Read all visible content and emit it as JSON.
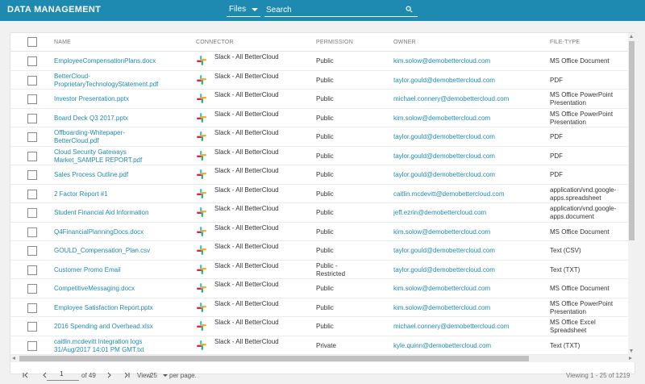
{
  "app": {
    "title": "DATA MANAGEMENT"
  },
  "search": {
    "scope": "Files",
    "placeholder": "Search"
  },
  "columns": [
    "NAME",
    "CONNECTOR",
    "PERMISSION",
    "OWNER",
    "FILE-TYPE"
  ],
  "rows": [
    {
      "name": [
        "EmployeeCompensationPlans.docx"
      ],
      "connector": "Slack - All BetterCloud",
      "permission": [
        "Public"
      ],
      "owner": "kim.solow@demobettercloud.com",
      "filetype": [
        "MS Office Document"
      ]
    },
    {
      "name": [
        "BetterCloud-",
        "ProprietaryTechnologyStatement.pdf"
      ],
      "connector": "Slack - All BetterCloud",
      "permission": [
        "Public"
      ],
      "owner": "taylor.gould@demobettercloud.com",
      "filetype": [
        "PDF"
      ]
    },
    {
      "name": [
        "Investor Presentation.pptx"
      ],
      "connector": "Slack - All BetterCloud",
      "permission": [
        "Public"
      ],
      "owner": "michael.connery@demobettercloud.com",
      "filetype": [
        "MS Office PowerPoint",
        "Presentation"
      ]
    },
    {
      "name": [
        "Board Deck Q3 2017.pptx"
      ],
      "connector": "Slack - All BetterCloud",
      "permission": [
        "Public"
      ],
      "owner": "kim.solow@demobettercloud.com",
      "filetype": [
        "MS Office PowerPoint",
        "Presentation"
      ]
    },
    {
      "name": [
        "Offboarding-Whitepaper-",
        "BetterCloud.pdf"
      ],
      "connector": "Slack - All BetterCloud",
      "permission": [
        "Public"
      ],
      "owner": "taylor.gould@demobettercloud.com",
      "filetype": [
        "PDF"
      ]
    },
    {
      "name": [
        "Cloud Security Gateways",
        "Market_SAMPLE REPORT.pdf"
      ],
      "connector": "Slack - All BetterCloud",
      "permission": [
        "Public"
      ],
      "owner": "taylor.gould@demobettercloud.com",
      "filetype": [
        "PDF"
      ]
    },
    {
      "name": [
        "Sales Process Outline.pdf"
      ],
      "connector": "Slack - All BetterCloud",
      "permission": [
        "Public"
      ],
      "owner": "taylor.gould@demobettercloud.com",
      "filetype": [
        "PDF"
      ]
    },
    {
      "name": [
        "2 Factor Report #1"
      ],
      "connector": "Slack - All BetterCloud",
      "permission": [
        "Public"
      ],
      "owner": "caitlin.mcdevitt@demobettercloud.com",
      "filetype": [
        "application/vnd.google-",
        "apps.spreadsheet"
      ]
    },
    {
      "name": [
        "Student Financial Aid Information"
      ],
      "connector": "Slack - All BetterCloud",
      "permission": [
        "Public"
      ],
      "owner": "jeff.ezrin@demobettercloud.com",
      "filetype": [
        "application/vnd.google-",
        "apps.document"
      ]
    },
    {
      "name": [
        "Q4FinancialPlanningDocs.docx"
      ],
      "connector": "Slack - All BetterCloud",
      "permission": [
        "Public"
      ],
      "owner": "kim.solow@demobettercloud.com",
      "filetype": [
        "MS Office Document"
      ]
    },
    {
      "name": [
        "GOULD_Compensation_Plan.csv"
      ],
      "connector": "Slack - All BetterCloud",
      "permission": [
        "Public"
      ],
      "owner": "taylor.gould@demobettercloud.com",
      "filetype": [
        "Text (CSV)"
      ]
    },
    {
      "name": [
        "Customer Promo Email"
      ],
      "connector": "Slack - All BetterCloud",
      "permission": [
        "Public -",
        "Restricted"
      ],
      "owner": "taylor.gould@demobettercloud.com",
      "filetype": [
        "Text (TXT)"
      ]
    },
    {
      "name": [
        "CompetitiveMessaging.docx"
      ],
      "connector": "Slack - All BetterCloud",
      "permission": [
        "Public"
      ],
      "owner": "kim.solow@demobettercloud.com",
      "filetype": [
        "MS Office Document"
      ]
    },
    {
      "name": [
        "Employee Satisfaction Report.pptx"
      ],
      "connector": "Slack - All BetterCloud",
      "permission": [
        "Public"
      ],
      "owner": "kim.solow@demobettercloud.com",
      "filetype": [
        "MS Office PowerPoint",
        "Presentation"
      ]
    },
    {
      "name": [
        "2016 Spending and Overhead.xlsx"
      ],
      "connector": "Slack - All BetterCloud",
      "permission": [
        "Public"
      ],
      "owner": "michael.connery@demobettercloud.com",
      "filetype": [
        "MS Office Excel",
        "Spreadsheet"
      ]
    },
    {
      "name": [
        "caitlin.mcdevitt Integration logs",
        "31/Aug/2017 14:01 PM GMT.txt"
      ],
      "connector": "Slack - All BetterCloud",
      "permission": [
        "Private"
      ],
      "owner": "kyle.quinn@demobettercloud.com",
      "filetype": [
        "Text (TXT)"
      ]
    }
  ],
  "pagination": {
    "page": "1",
    "of_pages": "of 49",
    "view_label": "View",
    "view_count": "25",
    "per_page": "per page.",
    "viewing": "Viewing 1 - 25 of 1219"
  },
  "colors": {
    "brand": "#1f8ab1",
    "link": "#1f8ab1"
  },
  "icons": {
    "connector": "slack-logo-icon",
    "search": "search-icon"
  }
}
